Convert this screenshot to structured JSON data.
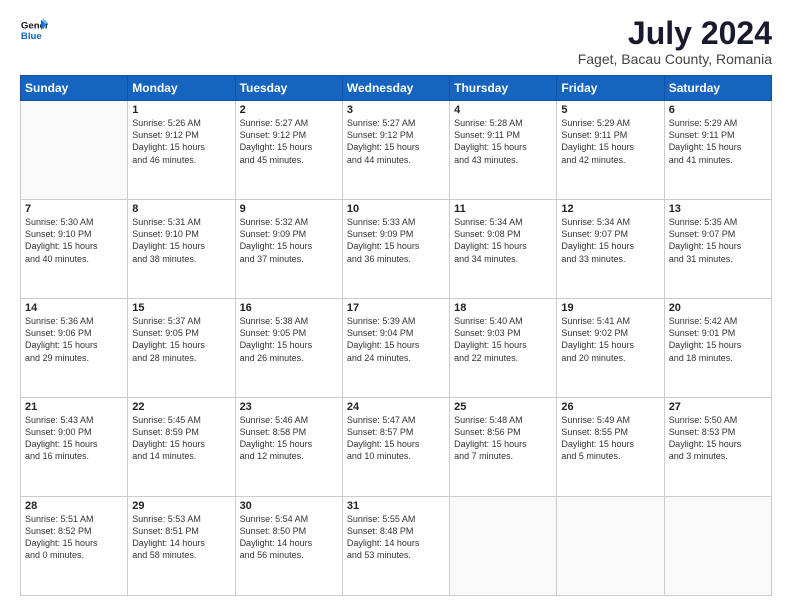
{
  "logo": {
    "line1": "General",
    "line2": "Blue"
  },
  "title": "July 2024",
  "subtitle": "Faget, Bacau County, Romania",
  "days_header": [
    "Sunday",
    "Monday",
    "Tuesday",
    "Wednesday",
    "Thursday",
    "Friday",
    "Saturday"
  ],
  "weeks": [
    [
      {
        "day": "",
        "info": ""
      },
      {
        "day": "1",
        "info": "Sunrise: 5:26 AM\nSunset: 9:12 PM\nDaylight: 15 hours\nand 46 minutes."
      },
      {
        "day": "2",
        "info": "Sunrise: 5:27 AM\nSunset: 9:12 PM\nDaylight: 15 hours\nand 45 minutes."
      },
      {
        "day": "3",
        "info": "Sunrise: 5:27 AM\nSunset: 9:12 PM\nDaylight: 15 hours\nand 44 minutes."
      },
      {
        "day": "4",
        "info": "Sunrise: 5:28 AM\nSunset: 9:11 PM\nDaylight: 15 hours\nand 43 minutes."
      },
      {
        "day": "5",
        "info": "Sunrise: 5:29 AM\nSunset: 9:11 PM\nDaylight: 15 hours\nand 42 minutes."
      },
      {
        "day": "6",
        "info": "Sunrise: 5:29 AM\nSunset: 9:11 PM\nDaylight: 15 hours\nand 41 minutes."
      }
    ],
    [
      {
        "day": "7",
        "info": "Sunrise: 5:30 AM\nSunset: 9:10 PM\nDaylight: 15 hours\nand 40 minutes."
      },
      {
        "day": "8",
        "info": "Sunrise: 5:31 AM\nSunset: 9:10 PM\nDaylight: 15 hours\nand 38 minutes."
      },
      {
        "day": "9",
        "info": "Sunrise: 5:32 AM\nSunset: 9:09 PM\nDaylight: 15 hours\nand 37 minutes."
      },
      {
        "day": "10",
        "info": "Sunrise: 5:33 AM\nSunset: 9:09 PM\nDaylight: 15 hours\nand 36 minutes."
      },
      {
        "day": "11",
        "info": "Sunrise: 5:34 AM\nSunset: 9:08 PM\nDaylight: 15 hours\nand 34 minutes."
      },
      {
        "day": "12",
        "info": "Sunrise: 5:34 AM\nSunset: 9:07 PM\nDaylight: 15 hours\nand 33 minutes."
      },
      {
        "day": "13",
        "info": "Sunrise: 5:35 AM\nSunset: 9:07 PM\nDaylight: 15 hours\nand 31 minutes."
      }
    ],
    [
      {
        "day": "14",
        "info": "Sunrise: 5:36 AM\nSunset: 9:06 PM\nDaylight: 15 hours\nand 29 minutes."
      },
      {
        "day": "15",
        "info": "Sunrise: 5:37 AM\nSunset: 9:05 PM\nDaylight: 15 hours\nand 28 minutes."
      },
      {
        "day": "16",
        "info": "Sunrise: 5:38 AM\nSunset: 9:05 PM\nDaylight: 15 hours\nand 26 minutes."
      },
      {
        "day": "17",
        "info": "Sunrise: 5:39 AM\nSunset: 9:04 PM\nDaylight: 15 hours\nand 24 minutes."
      },
      {
        "day": "18",
        "info": "Sunrise: 5:40 AM\nSunset: 9:03 PM\nDaylight: 15 hours\nand 22 minutes."
      },
      {
        "day": "19",
        "info": "Sunrise: 5:41 AM\nSunset: 9:02 PM\nDaylight: 15 hours\nand 20 minutes."
      },
      {
        "day": "20",
        "info": "Sunrise: 5:42 AM\nSunset: 9:01 PM\nDaylight: 15 hours\nand 18 minutes."
      }
    ],
    [
      {
        "day": "21",
        "info": "Sunrise: 5:43 AM\nSunset: 9:00 PM\nDaylight: 15 hours\nand 16 minutes."
      },
      {
        "day": "22",
        "info": "Sunrise: 5:45 AM\nSunset: 8:59 PM\nDaylight: 15 hours\nand 14 minutes."
      },
      {
        "day": "23",
        "info": "Sunrise: 5:46 AM\nSunset: 8:58 PM\nDaylight: 15 hours\nand 12 minutes."
      },
      {
        "day": "24",
        "info": "Sunrise: 5:47 AM\nSunset: 8:57 PM\nDaylight: 15 hours\nand 10 minutes."
      },
      {
        "day": "25",
        "info": "Sunrise: 5:48 AM\nSunset: 8:56 PM\nDaylight: 15 hours\nand 7 minutes."
      },
      {
        "day": "26",
        "info": "Sunrise: 5:49 AM\nSunset: 8:55 PM\nDaylight: 15 hours\nand 5 minutes."
      },
      {
        "day": "27",
        "info": "Sunrise: 5:50 AM\nSunset: 8:53 PM\nDaylight: 15 hours\nand 3 minutes."
      }
    ],
    [
      {
        "day": "28",
        "info": "Sunrise: 5:51 AM\nSunset: 8:52 PM\nDaylight: 15 hours\nand 0 minutes."
      },
      {
        "day": "29",
        "info": "Sunrise: 5:53 AM\nSunset: 8:51 PM\nDaylight: 14 hours\nand 58 minutes."
      },
      {
        "day": "30",
        "info": "Sunrise: 5:54 AM\nSunset: 8:50 PM\nDaylight: 14 hours\nand 56 minutes."
      },
      {
        "day": "31",
        "info": "Sunrise: 5:55 AM\nSunset: 8:48 PM\nDaylight: 14 hours\nand 53 minutes."
      },
      {
        "day": "",
        "info": ""
      },
      {
        "day": "",
        "info": ""
      },
      {
        "day": "",
        "info": ""
      }
    ]
  ]
}
